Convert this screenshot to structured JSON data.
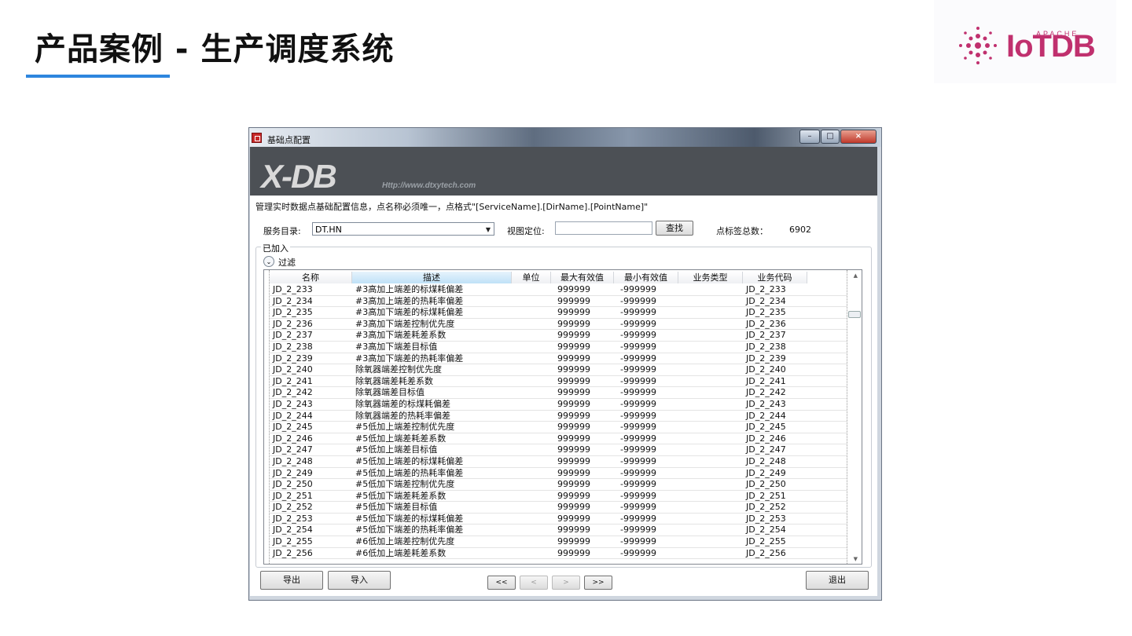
{
  "slide": {
    "title": "产品案例 - 生产调度系统",
    "logo_top": "APACHE",
    "logo_main": "IoTDB"
  },
  "window": {
    "title": "基础点配置",
    "banner_logo": "X-DB",
    "banner_url": "Http://www.dtxytech.com",
    "info": "管理实时数据点基础配置信息，点名称必须唯一，点格式\"[ServiceName].[DirName].[PointName]\"",
    "service_dir_label": "服务目录:",
    "service_dir_value": "DT.HN",
    "locate_label": "视图定位:",
    "locate_value": "",
    "find_button": "查找",
    "count_label": "点标签总数：",
    "count_value": "6902",
    "group_label": "已加入",
    "filter_label": "过滤",
    "columns": [
      "名称",
      "描述",
      "单位",
      "最大有效值",
      "最小有效值",
      "业务类型",
      "业务代码"
    ],
    "rows": [
      [
        "JD_2_233",
        "#3高加上端差的标煤耗偏差",
        "",
        "999999",
        "-999999",
        "",
        "JD_2_233"
      ],
      [
        "JD_2_234",
        "#3高加上端差的热耗率偏差",
        "",
        "999999",
        "-999999",
        "",
        "JD_2_234"
      ],
      [
        "JD_2_235",
        "#3高加下端差的标煤耗偏差",
        "",
        "999999",
        "-999999",
        "",
        "JD_2_235"
      ],
      [
        "JD_2_236",
        "#3高加下端差控制优先度",
        "",
        "999999",
        "-999999",
        "",
        "JD_2_236"
      ],
      [
        "JD_2_237",
        "#3高加下端差耗差系数",
        "",
        "999999",
        "-999999",
        "",
        "JD_2_237"
      ],
      [
        "JD_2_238",
        "#3高加下端差目标值",
        "",
        "999999",
        "-999999",
        "",
        "JD_2_238"
      ],
      [
        "JD_2_239",
        "#3高加下端差的热耗率偏差",
        "",
        "999999",
        "-999999",
        "",
        "JD_2_239"
      ],
      [
        "JD_2_240",
        "除氧器端差控制优先度",
        "",
        "999999",
        "-999999",
        "",
        "JD_2_240"
      ],
      [
        "JD_2_241",
        "除氧器端差耗差系数",
        "",
        "999999",
        "-999999",
        "",
        "JD_2_241"
      ],
      [
        "JD_2_242",
        "除氧器端差目标值",
        "",
        "999999",
        "-999999",
        "",
        "JD_2_242"
      ],
      [
        "JD_2_243",
        "除氧器端差的标煤耗偏差",
        "",
        "999999",
        "-999999",
        "",
        "JD_2_243"
      ],
      [
        "JD_2_244",
        "除氧器端差的热耗率偏差",
        "",
        "999999",
        "-999999",
        "",
        "JD_2_244"
      ],
      [
        "JD_2_245",
        "#5低加上端差控制优先度",
        "",
        "999999",
        "-999999",
        "",
        "JD_2_245"
      ],
      [
        "JD_2_246",
        "#5低加上端差耗差系数",
        "",
        "999999",
        "-999999",
        "",
        "JD_2_246"
      ],
      [
        "JD_2_247",
        "#5低加上端差目标值",
        "",
        "999999",
        "-999999",
        "",
        "JD_2_247"
      ],
      [
        "JD_2_248",
        "#5低加上端差的标煤耗偏差",
        "",
        "999999",
        "-999999",
        "",
        "JD_2_248"
      ],
      [
        "JD_2_249",
        "#5低加上端差的热耗率偏差",
        "",
        "999999",
        "-999999",
        "",
        "JD_2_249"
      ],
      [
        "JD_2_250",
        "#5低加下端差控制优先度",
        "",
        "999999",
        "-999999",
        "",
        "JD_2_250"
      ],
      [
        "JD_2_251",
        "#5低加下端差耗差系数",
        "",
        "999999",
        "-999999",
        "",
        "JD_2_251"
      ],
      [
        "JD_2_252",
        "#5低加下端差目标值",
        "",
        "999999",
        "-999999",
        "",
        "JD_2_252"
      ],
      [
        "JD_2_253",
        "#5低加下端差的标煤耗偏差",
        "",
        "999999",
        "-999999",
        "",
        "JD_2_253"
      ],
      [
        "JD_2_254",
        "#5低加下端差的热耗率偏差",
        "",
        "999999",
        "-999999",
        "",
        "JD_2_254"
      ],
      [
        "JD_2_255",
        "#6低加上端差控制优先度",
        "",
        "999999",
        "-999999",
        "",
        "JD_2_255"
      ],
      [
        "JD_2_256",
        "#6低加上端差耗差系数",
        "",
        "999999",
        "-999999",
        "",
        "JD_2_256"
      ]
    ],
    "export_button": "导出",
    "import_button": "导入",
    "first_button": "<<",
    "prev_button": "<",
    "next_button": ">",
    "last_button": ">>",
    "exit_button": "退出"
  },
  "colors": {
    "title_underline": "#2e86de",
    "logo": "#c0306e",
    "banner": "#4c5055"
  }
}
